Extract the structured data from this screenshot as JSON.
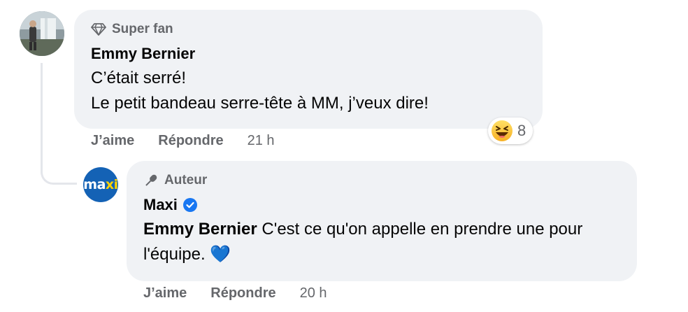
{
  "comments": [
    {
      "badge": "Super fan",
      "author": "Emmy Bernier",
      "lines": [
        "C’était serré!",
        "Le petit bandeau serre-tête à MM, j’veux dire!"
      ],
      "actions": {
        "like": "J’aime",
        "reply": "Répondre",
        "time": "21 h"
      },
      "reaction": {
        "icon": "laughing-emoji-icon",
        "count": "8"
      }
    },
    {
      "badge": "Auteur",
      "author": "Maxi",
      "verified": true,
      "avatar_text_main": "ma",
      "avatar_text_accent": "xi",
      "mention": "Emmy Bernier",
      "text": " C'est ce qu'on appelle en prendre une pour l'équipe.",
      "emoji": "💙",
      "actions": {
        "like": "J’aime",
        "reply": "Répondre",
        "time": "20 h"
      }
    }
  ],
  "colors": {
    "bubble": "#f0f2f5",
    "secondary_text": "#65676b",
    "verified": "#1877f2",
    "maxi_blue": "#1462b5"
  }
}
